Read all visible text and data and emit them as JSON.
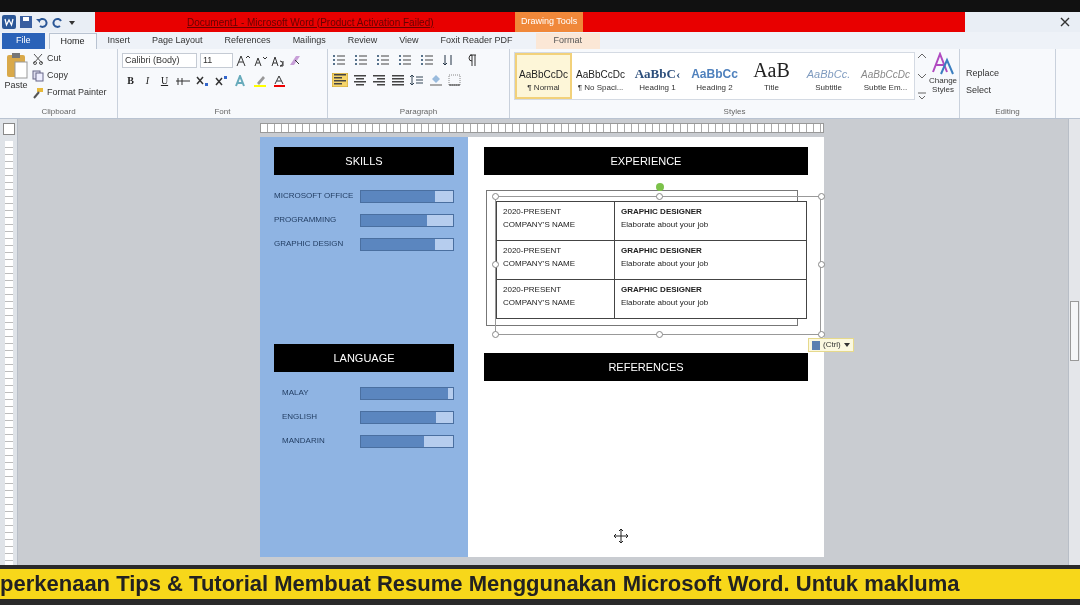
{
  "window": {
    "title": "Document1 - Microsoft Word (Product Activation Failed)",
    "context_tab": "Drawing Tools"
  },
  "tabs": [
    {
      "label": "File",
      "kind": "file",
      "selected": false
    },
    {
      "label": "Home",
      "kind": "tab",
      "selected": true
    },
    {
      "label": "Insert",
      "kind": "tab",
      "selected": false
    },
    {
      "label": "Page Layout",
      "kind": "tab",
      "selected": false
    },
    {
      "label": "References",
      "kind": "tab",
      "selected": false
    },
    {
      "label": "Mailings",
      "kind": "tab",
      "selected": false
    },
    {
      "label": "Review",
      "kind": "tab",
      "selected": false
    },
    {
      "label": "View",
      "kind": "tab",
      "selected": false
    },
    {
      "label": "Foxit Reader PDF",
      "kind": "tab",
      "selected": false
    },
    {
      "label": "Format",
      "kind": "context",
      "selected": false
    }
  ],
  "ribbon": {
    "clipboard": {
      "label": "Clipboard",
      "paste": "Paste",
      "items": [
        "Cut",
        "Copy",
        "Format Painter"
      ]
    },
    "font": {
      "label": "Font",
      "font_name": "Calibri (Body)",
      "font_size": "11",
      "format_buttons": [
        "B",
        "I",
        "U"
      ]
    },
    "paragraph": {
      "label": "Paragraph"
    },
    "styles": {
      "label": "Styles",
      "items": [
        {
          "sample": "AaBbCcDc",
          "name": "¶ Normal",
          "kind": "normal",
          "selected": true
        },
        {
          "sample": "AaBbCcDc",
          "name": "¶ No Spaci...",
          "kind": "normal",
          "selected": false
        },
        {
          "sample": "AaBbC‹",
          "name": "Heading 1",
          "kind": "heading1",
          "selected": false
        },
        {
          "sample": "AaBbCc",
          "name": "Heading 2",
          "kind": "heading2",
          "selected": false
        },
        {
          "sample": "AaB",
          "name": "Title",
          "kind": "title",
          "selected": false
        },
        {
          "sample": "AaBbCc.",
          "name": "Subtitle",
          "kind": "subtitle",
          "selected": false
        },
        {
          "sample": "AaBbCcDc",
          "name": "Subtle Em...",
          "kind": "subtle",
          "selected": false
        }
      ],
      "change_styles": "Change Styles"
    },
    "editing": {
      "label": "Editing",
      "items": [
        "Replace",
        "Select"
      ]
    }
  },
  "document": {
    "left_column": {
      "skills": {
        "heading": "SKILLS",
        "items": [
          {
            "name": "MICROSOFT OFFICE",
            "level": 0.8
          },
          {
            "name": "PROGRAMMING",
            "level": 0.72
          },
          {
            "name": "GRAPHIC DESIGN",
            "level": 0.8
          }
        ]
      },
      "language": {
        "heading": "LANGUAGE",
        "items": [
          {
            "name": "MALAY",
            "level": 0.95
          },
          {
            "name": "ENGLISH",
            "level": 0.82
          },
          {
            "name": "MANDARIN",
            "level": 0.68
          }
        ]
      }
    },
    "right_column": {
      "experience": {
        "heading": "EXPERIENCE",
        "rows": [
          {
            "period": "2020-PRESENT",
            "company": "COMPANY'S NAME",
            "role": "GRAPHIC DESIGNER",
            "description": "Elaborate about your job"
          },
          {
            "period": "2020-PRESENT",
            "company": "COMPANY'S NAME",
            "role": "GRAPHIC DESIGNER",
            "description": "Elaborate about your job"
          },
          {
            "period": "2020-PRESENT",
            "company": "COMPANY'S NAME",
            "role": "GRAPHIC DESIGNER",
            "description": "Elaborate about your job"
          }
        ]
      },
      "paste_options": "(Ctrl)",
      "references": {
        "heading": "REFERENCES"
      }
    }
  },
  "caption": "perkenaan Tips & Tutorial Membuat Resume Menggunakan Microsoft Word. Untuk makluma"
}
